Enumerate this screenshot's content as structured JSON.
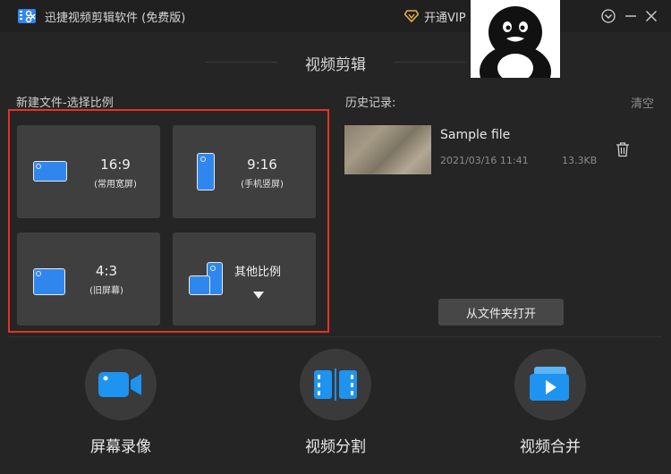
{
  "app": {
    "title": "迅捷视频剪辑软件 (免费版)",
    "vip_label": "开通VIP"
  },
  "section_title": "视频剪辑",
  "new_file": {
    "label": "新建文件-选择比例",
    "ratios": [
      {
        "ratio": "16:9",
        "desc": "(常用宽屏)"
      },
      {
        "ratio": "9:16",
        "desc": "(手机竖屏)"
      },
      {
        "ratio": "4:3",
        "desc": "(旧屏幕)"
      },
      {
        "ratio": "其他比例",
        "desc": ""
      }
    ]
  },
  "history": {
    "label": "历史记录:",
    "clear_label": "清空",
    "items": [
      {
        "name": "Sample file",
        "date": "2021/03/16 11:41",
        "size": "13.3KB"
      }
    ],
    "open_folder_label": "从文件夹打开"
  },
  "tools": [
    {
      "label": "屏幕录像",
      "icon": "camera-icon"
    },
    {
      "label": "视频分割",
      "icon": "split-icon"
    },
    {
      "label": "视频合并",
      "icon": "merge-icon"
    }
  ],
  "colors": {
    "accent": "#2f87ee",
    "highlight_frame": "#e53325",
    "vip": "#e8b04a"
  }
}
